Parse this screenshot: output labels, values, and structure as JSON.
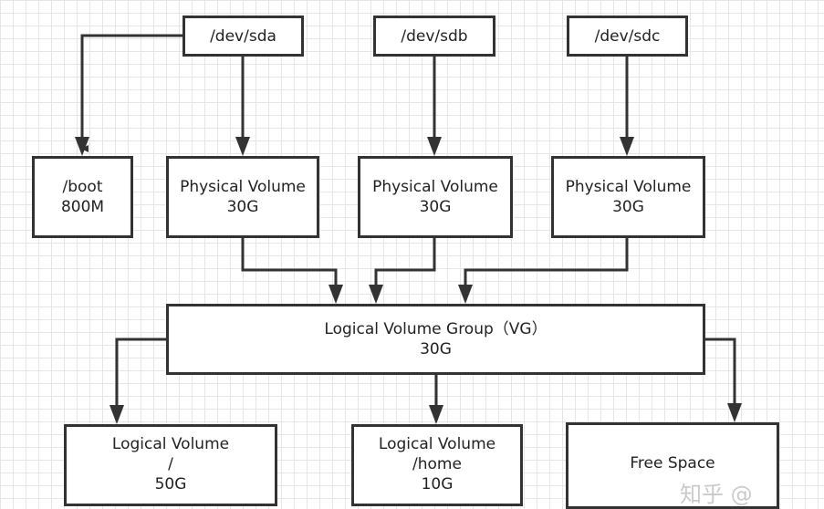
{
  "devices": [
    {
      "label": "/dev/sda"
    },
    {
      "label": "/dev/sdb"
    },
    {
      "label": "/dev/sdc"
    }
  ],
  "boot": {
    "line1": "/boot",
    "line2": "800M"
  },
  "physical_volumes": [
    {
      "line1": "Physical Volume",
      "line2": "30G"
    },
    {
      "line1": "Physical Volume",
      "line2": "30G"
    },
    {
      "line1": "Physical Volume",
      "line2": "30G"
    }
  ],
  "volume_group": {
    "line1": "Logical Volume Group（VG）",
    "line2": "30G"
  },
  "logical_volumes": [
    {
      "line1": "Logical Volume",
      "line2": "/",
      "line3": "50G"
    },
    {
      "line1": "Logical Volume",
      "line2": "/home",
      "line3": "10G"
    }
  ],
  "free_space": {
    "label": "Free Space"
  },
  "watermark": "知乎 @"
}
